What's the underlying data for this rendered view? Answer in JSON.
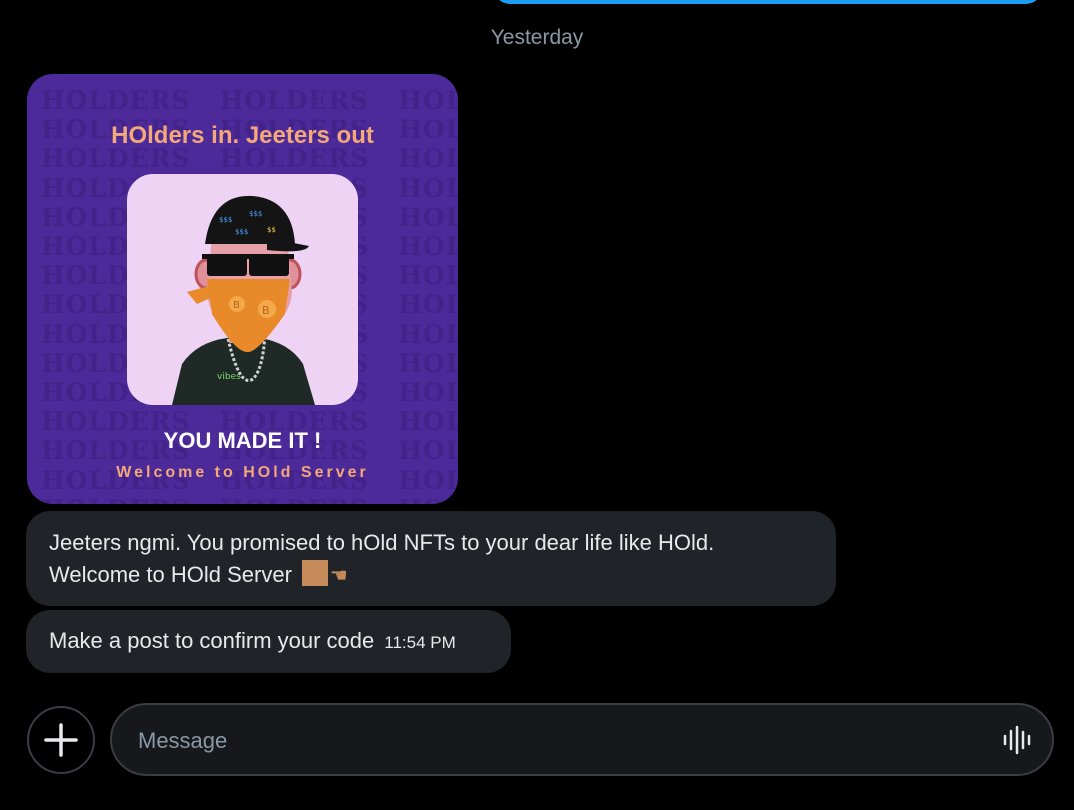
{
  "conversation": {
    "date_separator": "Yesterday"
  },
  "image_card": {
    "watermark_text": "HOLDERS",
    "headline": "HOlders in. Jeeters out",
    "title": "YOU MADE IT !",
    "subtitle": "Welcome to HOld Server",
    "background_color": "#4d2a9a",
    "accent_color": "#f2a878"
  },
  "messages": [
    {
      "line1": "Jeeters ngmi. You promised to hOld NFTs to your dear life like HOld.",
      "line2": "Welcome to HOld Server"
    },
    {
      "text": "Make a post to confirm your code",
      "time": "11:54 PM"
    }
  ],
  "composer": {
    "placeholder": "Message",
    "add_icon": "plus-icon",
    "voice_icon": "waveform-icon"
  },
  "colors": {
    "background": "#000000",
    "bubble": "#202327",
    "sent_bubble": "#1d9bf0",
    "muted_text": "#8b98a5"
  }
}
